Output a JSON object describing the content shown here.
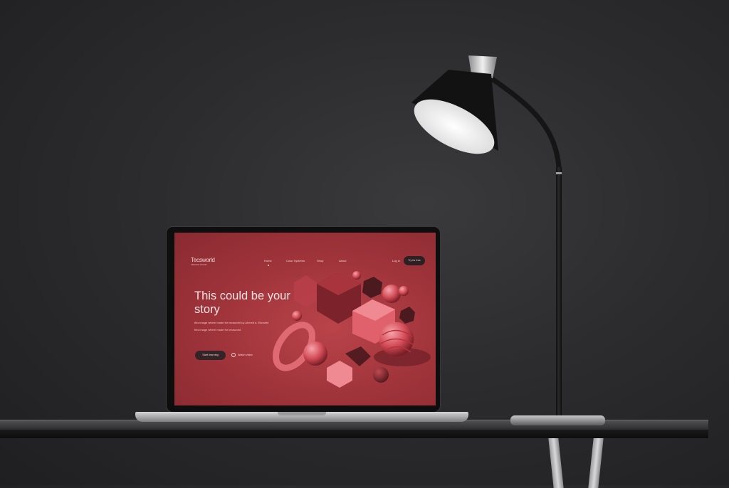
{
  "site": {
    "logo": "Tecsworld",
    "logo_sub": "CREATIVE STUDIO",
    "nav": {
      "home": "Home",
      "color_systems": "Color Systems",
      "shop": "Shop",
      "about": "About",
      "login": "Log in",
      "try": "Try for free"
    },
    "hero": {
      "headline": "This could be your story",
      "desc_1": "this image where made for tecsworld by Ahmed a. Elmarlef",
      "desc_2": "this image where made for tecsworld."
    },
    "buttons": {
      "learn": "Start learning",
      "watch": "Watch video"
    }
  },
  "colors": {
    "screen_bg": "#a0343b",
    "accent_pink": "#f08a92",
    "dark_button": "#2d2022",
    "wall": "#2c2c2e"
  },
  "icons": {
    "play": "play-circle-icon"
  }
}
